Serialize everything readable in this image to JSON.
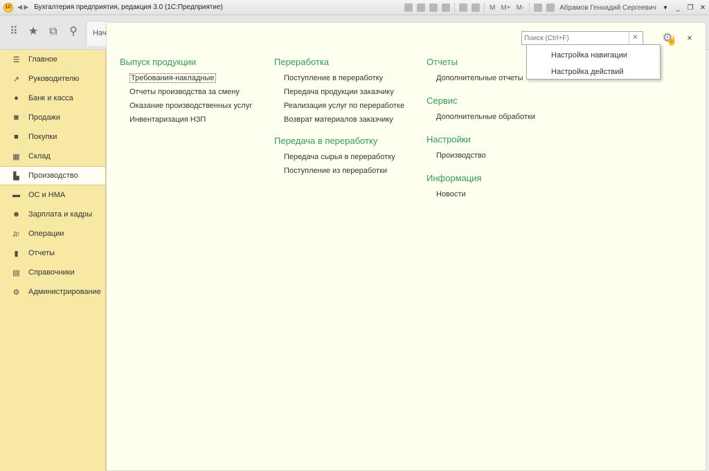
{
  "app": {
    "logo_text": "1С",
    "window_title": "Бухгалтерия предприятия, редакция 3.0  (1С:Предприятие)",
    "user_name": "Абрамов Геннадий Сергеевич",
    "toolbar_labels": [
      "M",
      "M+",
      "M-"
    ]
  },
  "toolbar": {
    "home_tab_label": "Нач"
  },
  "sidebar": {
    "items": [
      {
        "label": "Главное",
        "icon": "menu-lines-icon",
        "active": false
      },
      {
        "label": "Руководителю",
        "icon": "trend-icon",
        "active": false
      },
      {
        "label": "Банк и касса",
        "icon": "coin-icon",
        "active": false
      },
      {
        "label": "Продажи",
        "icon": "basket-icon",
        "active": false
      },
      {
        "label": "Покупки",
        "icon": "cart-icon",
        "active": false
      },
      {
        "label": "Склад",
        "icon": "warehouse-icon",
        "active": false
      },
      {
        "label": "Производство",
        "icon": "factory-icon",
        "active": true
      },
      {
        "label": "ОС и НМА",
        "icon": "truck-icon",
        "active": false
      },
      {
        "label": "Зарплата и кадры",
        "icon": "person-icon",
        "active": false
      },
      {
        "label": "Операции",
        "icon": "dt-kt-icon",
        "active": false
      },
      {
        "label": "Отчеты",
        "icon": "bar-chart-icon",
        "active": false
      },
      {
        "label": "Справочники",
        "icon": "books-icon",
        "active": false
      },
      {
        "label": "Администрирование",
        "icon": "gear-icon",
        "active": false
      }
    ]
  },
  "panel": {
    "search_placeholder": "Поиск (Ctrl+F)",
    "close_label": "×",
    "col1": {
      "groups": [
        {
          "title": "Выпуск продукции",
          "links": [
            "Требования-накладные",
            "Отчеты производства за смену",
            "Оказание производственных услуг",
            "Инвентаризация НЗП"
          ]
        }
      ]
    },
    "col2": {
      "groups": [
        {
          "title": "Переработка",
          "links": [
            "Поступление в переработку",
            "Передача продукции заказчику",
            "Реализация услуг по переработке",
            "Возврат материалов заказчику"
          ]
        },
        {
          "title": "Передача в переработку",
          "links": [
            "Передача сырья в переработку",
            "Поступление из переработки"
          ]
        }
      ]
    },
    "col3": {
      "groups": [
        {
          "title": "Отчеты",
          "links": [
            "Дополнительные отчеты"
          ]
        },
        {
          "title": "Сервис",
          "links": [
            "Дополнительные обработки"
          ]
        },
        {
          "title": "Настройки",
          "links": [
            "Производство"
          ]
        },
        {
          "title": "Информация",
          "links": [
            "Новости"
          ]
        }
      ]
    }
  },
  "dropdown": {
    "items": [
      "Настройка навигации",
      "Настройка действий"
    ]
  }
}
